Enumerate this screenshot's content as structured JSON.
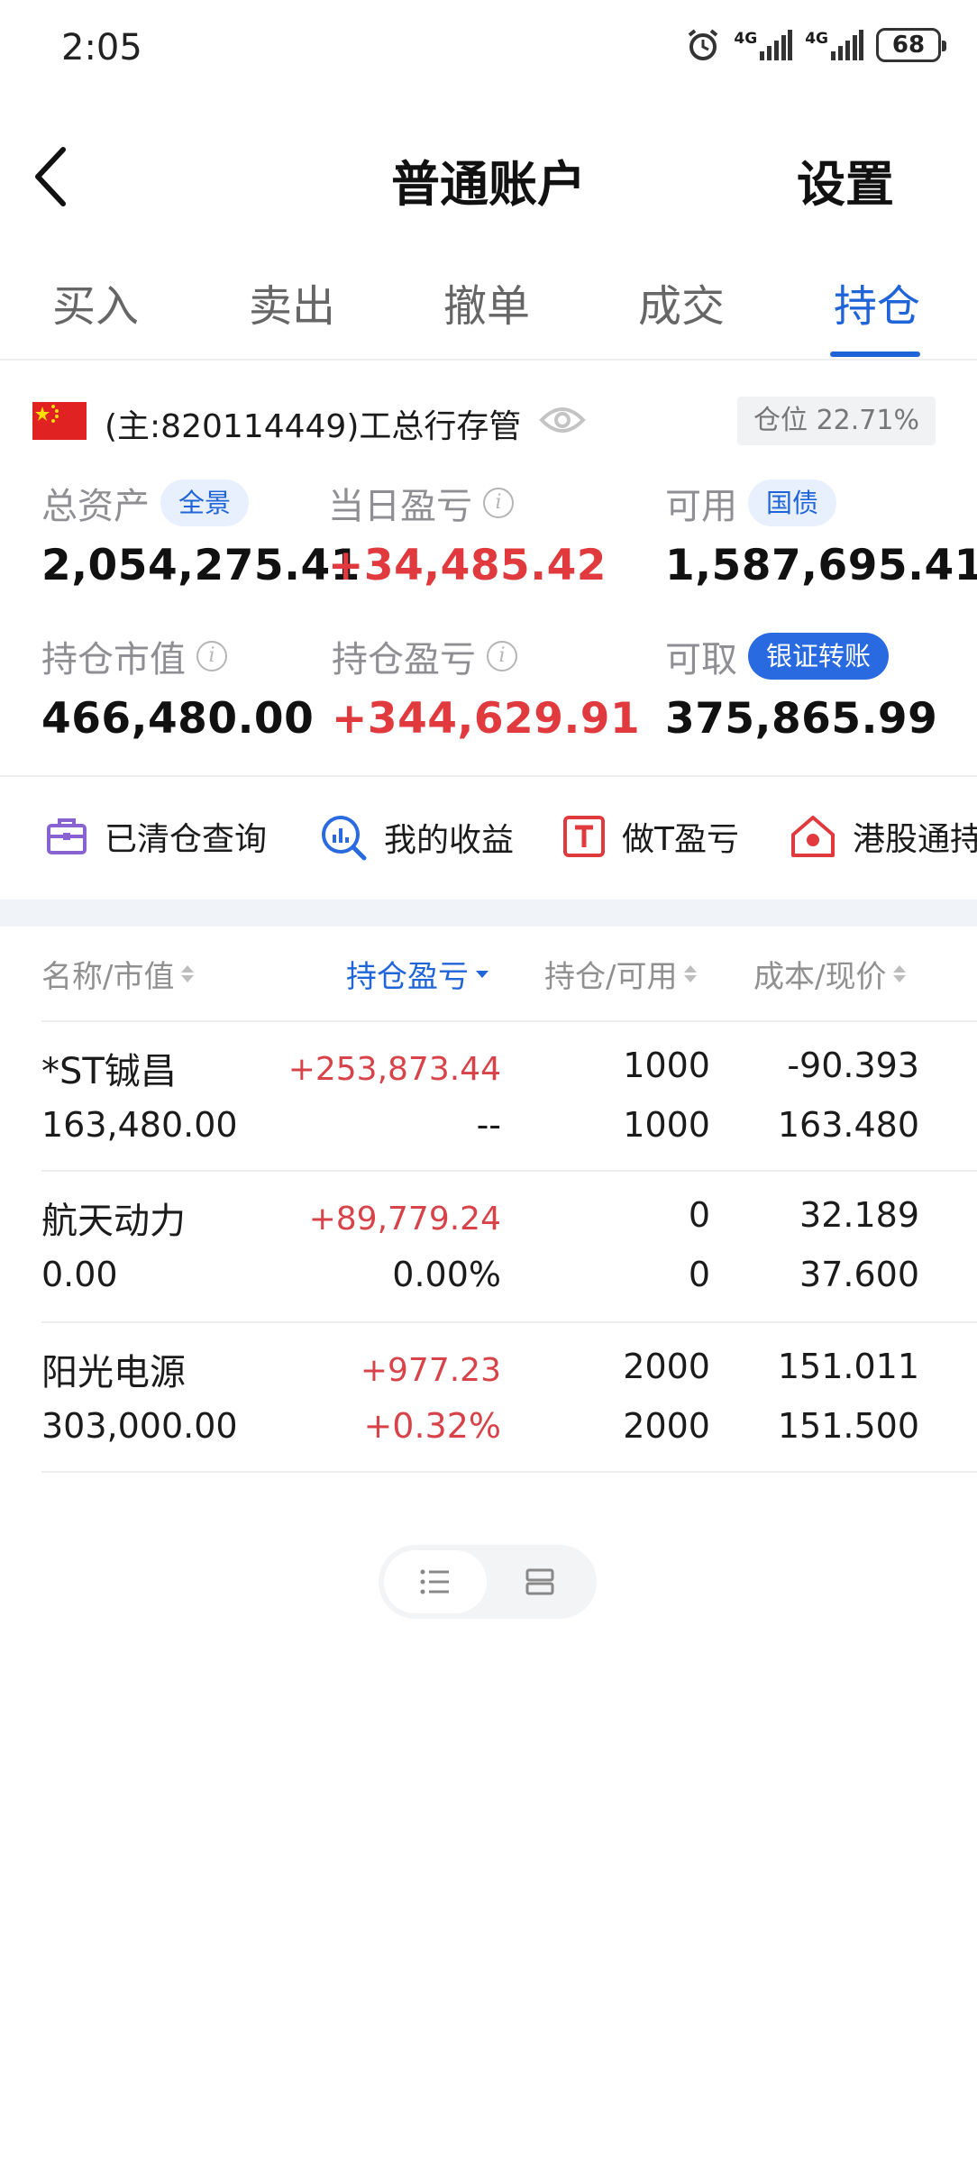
{
  "status_bar": {
    "time": "2:05",
    "signal1": "4G",
    "signal2": "4G",
    "battery": "68"
  },
  "header": {
    "title": "普通账户",
    "settings_label": "设置"
  },
  "tabs": [
    {
      "label": "买入",
      "active": false
    },
    {
      "label": "卖出",
      "active": false
    },
    {
      "label": "撤单",
      "active": false
    },
    {
      "label": "成交",
      "active": false
    },
    {
      "label": "持仓",
      "active": true
    }
  ],
  "account": {
    "name": "(主:820114449)工总行存管",
    "position_ratio": "仓位 22.71%"
  },
  "summary": {
    "total_assets": {
      "label": "总资产",
      "tag": "全景",
      "value": "2,054,275.41"
    },
    "daily_pnl": {
      "label": "当日盈亏",
      "value": "+34,485.42"
    },
    "available": {
      "label": "可用",
      "tag": "国债",
      "value": "1,587,695.41"
    },
    "market_value": {
      "label": "持仓市值",
      "value": "466,480.00"
    },
    "position_pnl": {
      "label": "持仓盈亏",
      "value": "+344,629.91"
    },
    "withdrawable": {
      "label": "可取",
      "tag": "银证转账",
      "value": "375,865.99"
    }
  },
  "quick_links": [
    {
      "label": "已清仓查询",
      "icon": "briefcase-icon"
    },
    {
      "label": "我的收益",
      "icon": "chart-search-icon"
    },
    {
      "label": "做T盈亏",
      "icon": "t-box-icon"
    },
    {
      "label": "港股通持",
      "icon": "hk-house-icon"
    }
  ],
  "table": {
    "headers": [
      "名称/市值",
      "持仓盈亏",
      "持仓/可用",
      "成本/现价"
    ],
    "rows": [
      {
        "name": "*ST铖昌",
        "market_value": "163,480.00",
        "pnl": "+253,873.44",
        "pnl_pct": "--",
        "holding": "1000",
        "available": "1000",
        "cost": "-90.393",
        "price": "163.480"
      },
      {
        "name": "航天动力",
        "market_value": "0.00",
        "pnl": "+89,779.24",
        "pnl_pct": "0.00%",
        "holding": "0",
        "available": "0",
        "cost": "32.189",
        "price": "37.600"
      },
      {
        "name": "阳光电源",
        "market_value": "303,000.00",
        "pnl": "+977.23",
        "pnl_pct": "+0.32%",
        "holding": "2000",
        "available": "2000",
        "cost": "151.011",
        "price": "151.500"
      }
    ]
  },
  "colors": {
    "accent": "#1f64d8",
    "gain": "#e03a3e",
    "muted": "#8e8e93"
  }
}
